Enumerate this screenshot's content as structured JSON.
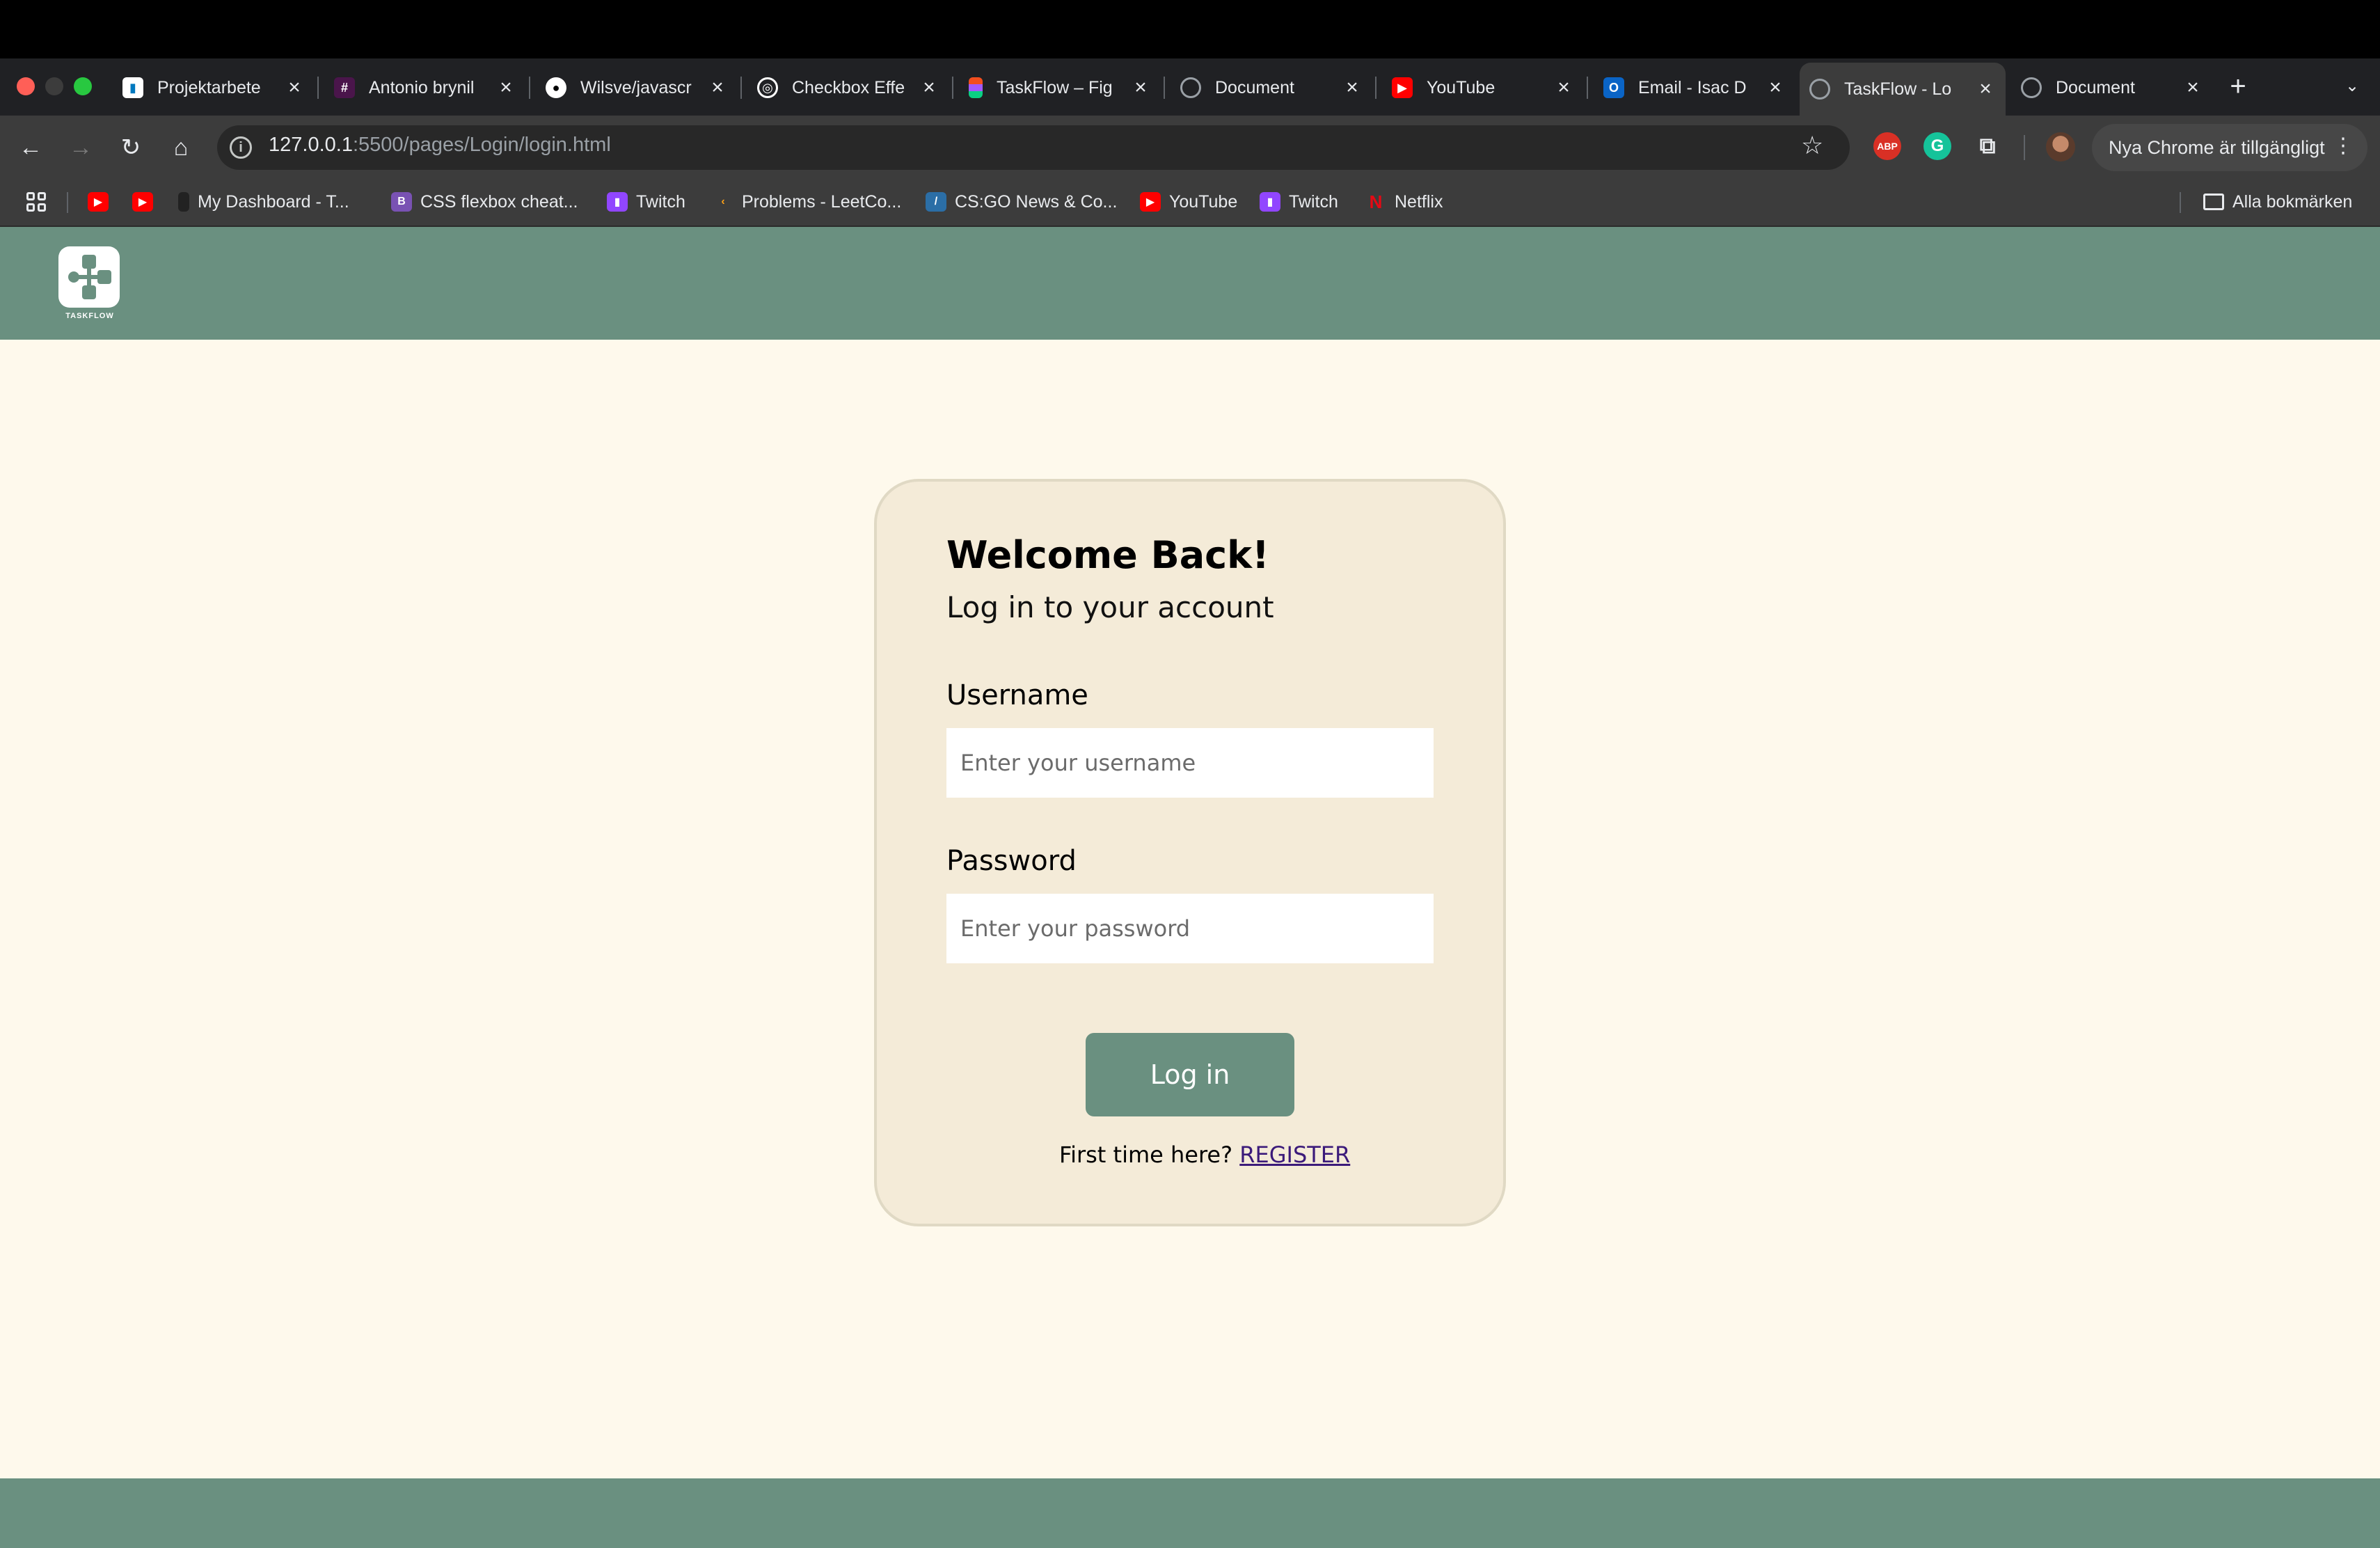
{
  "browser": {
    "tabs": [
      {
        "label": "Projektarbete",
        "icon": "trello-icon",
        "active": false
      },
      {
        "label": "Antonio brynil",
        "icon": "slack-icon",
        "active": false
      },
      {
        "label": "Wilsve/javascr",
        "icon": "github-icon",
        "active": false
      },
      {
        "label": "Checkbox Effe",
        "icon": "codepen-icon",
        "active": false
      },
      {
        "label": "TaskFlow – Fig",
        "icon": "figma-icon",
        "active": false
      },
      {
        "label": "Document",
        "icon": "globe-icon",
        "active": false
      },
      {
        "label": "YouTube",
        "icon": "youtube-icon",
        "active": false
      },
      {
        "label": "Email - Isac D",
        "icon": "outlook-icon",
        "active": false
      },
      {
        "label": "TaskFlow - Lo",
        "icon": "globe-icon",
        "active": true
      },
      {
        "label": "Document",
        "icon": "globe-icon",
        "active": false
      }
    ],
    "url_host": "127.0.0.1",
    "url_path": ":5500/pages/Login/login.html",
    "update_label": "Nya Chrome är tillgängligt",
    "bookmarks": [
      {
        "label": "My Dashboard - T...",
        "icon": "dashboard-icon"
      },
      {
        "label": "CSS flexbox cheat...",
        "icon": "bootstrap-icon"
      },
      {
        "label": "Twitch",
        "icon": "twitch-icon"
      },
      {
        "label": "Problems - LeetCo...",
        "icon": "leetcode-icon"
      },
      {
        "label": "CS:GO News & Co...",
        "icon": "hltv-icon"
      },
      {
        "label": "YouTube",
        "icon": "youtube-icon"
      },
      {
        "label": "Twitch",
        "icon": "twitch-icon"
      },
      {
        "label": "Netflix",
        "icon": "netflix-icon"
      }
    ],
    "all_bookmarks_label": "Alla bokmärken"
  },
  "site": {
    "logo_text": "TASKFLOW",
    "accent_color": "#6a9080",
    "background_color": "#fef9ec"
  },
  "login": {
    "title": "Welcome Back!",
    "subtitle": "Log in to your account",
    "username_label": "Username",
    "username_placeholder": "Enter your username",
    "password_label": "Password",
    "password_placeholder": "Enter your password",
    "submit_label": "Log in",
    "register_prompt": "First time here?",
    "register_link": "REGISTER"
  }
}
